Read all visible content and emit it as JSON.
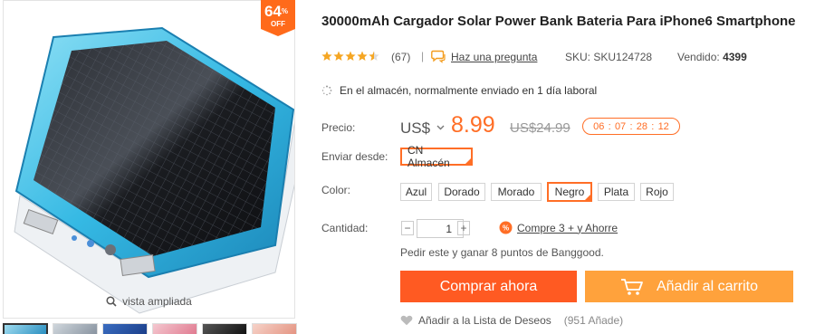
{
  "gallery": {
    "zoom_caption": "vista ampliada",
    "badge_number": "64",
    "badge_percent": "%",
    "badge_off": "OFF",
    "icons": [
      "magnifier-icon"
    ]
  },
  "product": {
    "title": "30000mAh Cargador Solar Power Bank Bateria Para iPhone6 Smartphone",
    "rating": 4,
    "reviews": "(67)",
    "separator": "|",
    "ask_label": "Haz una pregunta",
    "sku": "SKU: SKU124728",
    "sold_label": "Vendido:",
    "sold_value": "4399",
    "stock_text": "En el almacén, normalmente enviado en 1 día laboral"
  },
  "price": {
    "label": "Precio:",
    "currency": "US$",
    "current": "8.99",
    "old": "US$24.99",
    "countdown": [
      "06",
      ":",
      "07",
      ":",
      "28",
      ":",
      "12"
    ]
  },
  "shipping": {
    "label": "Enviar desde:",
    "options": [
      "CN Almacén"
    ]
  },
  "color": {
    "label": "Color:",
    "options": [
      "Azul",
      "Dorado",
      "Morado",
      "Negro",
      "Plata",
      "Rojo"
    ],
    "selected": "Negro"
  },
  "quantity": {
    "label": "Cantidad:",
    "minus": "−",
    "value": "1",
    "plus": "+",
    "deal_text": "Compre 3 + y Ahorre",
    "points_text": "Pedir este y ganar 8 puntos de Banggood."
  },
  "actions": {
    "buy_now": "Comprar ahora",
    "add_to_cart": "Añadir al carrito",
    "wishlist": "Añadir a la Lista de Deseos",
    "wishlist_count": "(951 Añade)"
  },
  "colors": {
    "accent": "#ff6e26",
    "buy": "#ff5a22",
    "cart": "#ffa23c",
    "star": "#f5a623"
  }
}
